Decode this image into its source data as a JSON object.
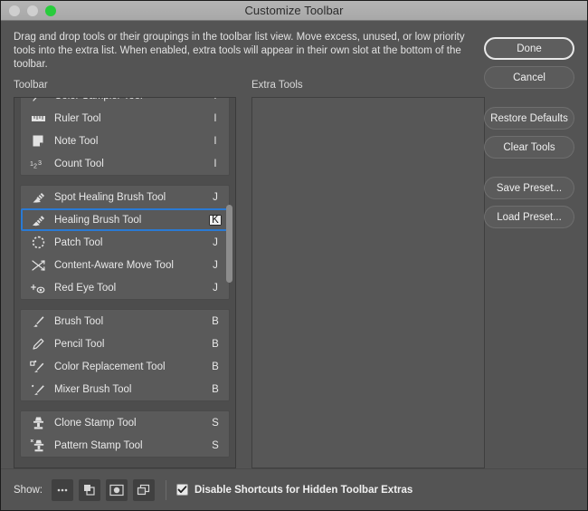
{
  "window": {
    "title": "Customize Toolbar",
    "traffic_lights": [
      "close-gray",
      "minimize-gray",
      "maximize-green"
    ]
  },
  "description": "Drag and drop tools or their groupings in the toolbar list view. Move excess, unused, or low priority tools into the extra list. When enabled, extra tools will appear in their own slot at the bottom of the toolbar.",
  "columns": {
    "toolbar_header": "Toolbar",
    "extra_header": "Extra Tools"
  },
  "toolbar_groups": [
    {
      "tools": [
        {
          "name": "Color Sampler Tool",
          "shortcut": "I",
          "icon": "color-sampler-icon",
          "clipped": true
        },
        {
          "name": "Ruler Tool",
          "shortcut": "I",
          "icon": "ruler-icon"
        },
        {
          "name": "Note Tool",
          "shortcut": "I",
          "icon": "note-icon"
        },
        {
          "name": "Count Tool",
          "shortcut": "I",
          "icon": "count-icon"
        }
      ]
    },
    {
      "tools": [
        {
          "name": "Spot Healing Brush Tool",
          "shortcut": "J",
          "icon": "spot-healing-brush-icon"
        },
        {
          "name": "Healing Brush Tool",
          "shortcut": "K",
          "icon": "healing-brush-icon",
          "selected": true
        },
        {
          "name": "Patch Tool",
          "shortcut": "J",
          "icon": "patch-icon"
        },
        {
          "name": "Content-Aware Move Tool",
          "shortcut": "J",
          "icon": "content-aware-move-icon"
        },
        {
          "name": "Red Eye Tool",
          "shortcut": "J",
          "icon": "red-eye-icon"
        }
      ]
    },
    {
      "tools": [
        {
          "name": "Brush Tool",
          "shortcut": "B",
          "icon": "brush-icon"
        },
        {
          "name": "Pencil Tool",
          "shortcut": "B",
          "icon": "pencil-icon"
        },
        {
          "name": "Color Replacement Tool",
          "shortcut": "B",
          "icon": "color-replacement-icon"
        },
        {
          "name": "Mixer Brush Tool",
          "shortcut": "B",
          "icon": "mixer-brush-icon"
        }
      ]
    },
    {
      "tools": [
        {
          "name": "Clone Stamp Tool",
          "shortcut": "S",
          "icon": "clone-stamp-icon"
        },
        {
          "name": "Pattern Stamp Tool",
          "shortcut": "S",
          "icon": "pattern-stamp-icon"
        }
      ]
    }
  ],
  "extra_tools": [],
  "buttons": {
    "done": "Done",
    "cancel": "Cancel",
    "restore_defaults": "Restore Defaults",
    "clear_tools": "Clear Tools",
    "save_preset": "Save Preset...",
    "load_preset": "Load Preset..."
  },
  "footer": {
    "show_label": "Show:",
    "icons": [
      "more-tools-icon",
      "foreground-background-color-icon",
      "quick-mask-icon",
      "screen-mode-icon"
    ],
    "checkbox_label": "Disable Shortcuts for Hidden Toolbar Extras",
    "checkbox_checked": true
  },
  "colors": {
    "dialog_bg": "#545454",
    "titlebar_bg": "#aeaeae",
    "group_bg": "#5a5a5a",
    "selection_border": "#2a7ad4",
    "maximize_green": "#28cc3c",
    "text": "#e8e8e8"
  }
}
